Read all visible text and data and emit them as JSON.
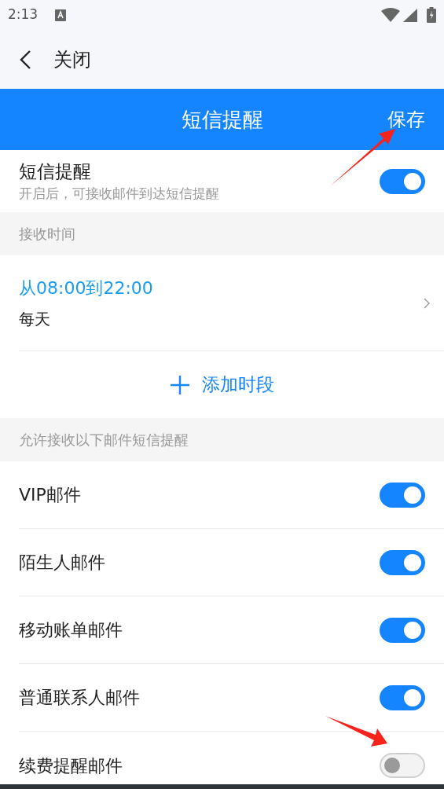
{
  "status_bar": {
    "time": "2:13"
  },
  "nav": {
    "back_label": "关闭"
  },
  "header": {
    "title": "短信提醒",
    "action": "保存"
  },
  "main_toggle": {
    "title": "短信提醒",
    "subtitle": "开启后，可接收邮件到达短信提醒",
    "on": true
  },
  "time_section": {
    "heading": "接收时间",
    "periods": [
      {
        "range": "从08:00到22:00",
        "repeat": "每天"
      }
    ],
    "add_label": "添加时段"
  },
  "mail_section": {
    "heading": "允许接收以下邮件短信提醒",
    "items": [
      {
        "label": "VIP邮件",
        "on": true
      },
      {
        "label": "陌生人邮件",
        "on": true
      },
      {
        "label": "移动账单邮件",
        "on": true
      },
      {
        "label": "普通联系人邮件",
        "on": true
      },
      {
        "label": "续费提醒邮件",
        "on": false
      }
    ]
  }
}
